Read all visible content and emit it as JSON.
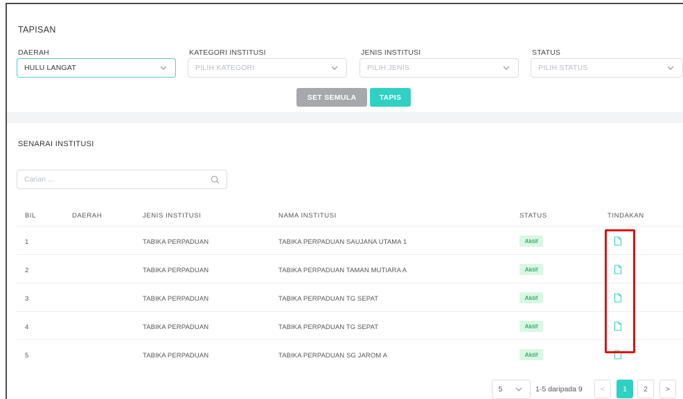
{
  "filter": {
    "title": "TAPISAN",
    "daerah": {
      "label": "DAERAH",
      "value": "HULU LANGAT"
    },
    "kategori": {
      "label": "KATEGORI INSTITUSI",
      "placeholder": "PILIH KATEGORI"
    },
    "jenis": {
      "label": "JENIS INSTITUSI",
      "placeholder": "PILIH JENIS"
    },
    "status": {
      "label": "STATUS",
      "placeholder": "PILIH STATUS"
    },
    "reset_label": "SET SEMULA",
    "filter_label": "TAPIS"
  },
  "list": {
    "title": "SENARAI INSTITUSI",
    "search_placeholder": "Carian ...",
    "columns": [
      "BIL",
      "DAERAH",
      "JENIS INSTITUSI",
      "NAMA INSTITUSI",
      "STATUS",
      "TINDAKAN"
    ],
    "rows": [
      {
        "bil": "1",
        "daerah": "",
        "jenis": "TABIKA PERPADUAN",
        "nama": "TABIKA PERPADUAN SAUJANA UTAMA 1",
        "status": "Aktif"
      },
      {
        "bil": "2",
        "daerah": "",
        "jenis": "TABIKA PERPADUAN",
        "nama": "TABIKA PERPADUAN TAMAN MUTIARA A",
        "status": "Aktif"
      },
      {
        "bil": "3",
        "daerah": "",
        "jenis": "TABIKA PERPADUAN",
        "nama": "TABIKA PERPADUAN TG SEPAT",
        "status": "Aktif"
      },
      {
        "bil": "4",
        "daerah": "",
        "jenis": "TABIKA PERPADUAN",
        "nama": "TABIKA PERPADUAN TG SEPAT",
        "status": "Aktif"
      },
      {
        "bil": "5",
        "daerah": "",
        "jenis": "TABIKA PERPADUAN",
        "nama": "TABIKA PERPADUAN SG JAROM A",
        "status": "Aktif"
      }
    ]
  },
  "pagination": {
    "page_size": "5",
    "info": "1-5 daripada 9",
    "prev": "<",
    "pages": [
      "1",
      "2"
    ],
    "next": ">"
  },
  "colors": {
    "accent": "#2fd1c3",
    "status_bg": "#d9f7e3",
    "status_text": "#2fb36b",
    "highlight": "#e01010"
  },
  "icons": {
    "select_chevron": "chevron-down-icon",
    "search": "search-icon",
    "action": "document-icon"
  }
}
